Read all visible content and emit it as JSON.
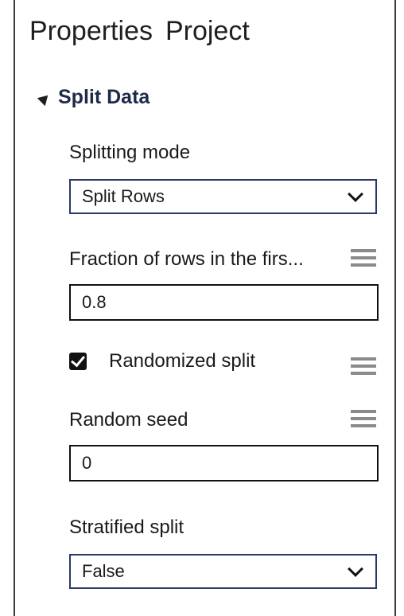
{
  "tabs": [
    "Properties",
    "Project"
  ],
  "section": {
    "title": "Split Data"
  },
  "splitting_mode": {
    "label": "Splitting mode",
    "value": "Split Rows"
  },
  "fraction": {
    "label": "Fraction of rows in the firs...",
    "value": "0.8"
  },
  "randomized": {
    "label": "Randomized split",
    "checked": true
  },
  "seed": {
    "label": "Random seed",
    "value": "0"
  },
  "stratified": {
    "label": "Stratified split",
    "value": "False"
  },
  "icons": {
    "collapse": "triangle-down-icon",
    "menu": "hamburger-menu-icon",
    "dropdown": "chevron-down-icon",
    "checkbox": "checkmark-icon"
  },
  "colors": {
    "section_title": "#1f2a4a",
    "select_border": "#2a3a66",
    "menu_icon": "#8a8a8a"
  }
}
